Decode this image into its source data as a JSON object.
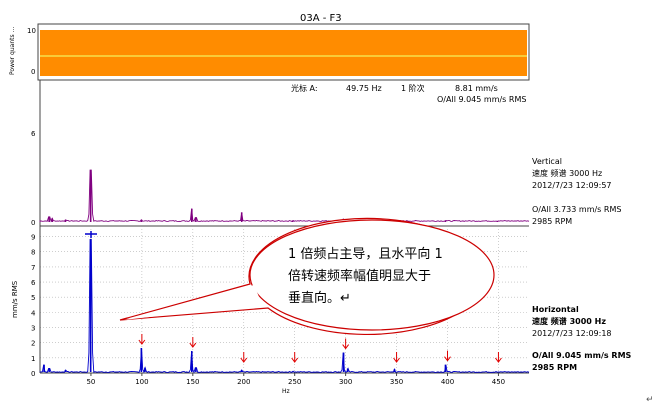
{
  "title": "03A - F3",
  "colors": {
    "power_band": "#ff8c00",
    "power_line": "#f5e04a",
    "vertical_line": "#800080",
    "horizontal_line": "#0000cc",
    "arrow": "#e00000",
    "callout_border": "#cc0000"
  },
  "power_panel": {
    "ylabel": "Power quants ...",
    "ticks": [
      "10",
      "0"
    ]
  },
  "cursor_readout": {
    "label": "光标 A:",
    "freq": "49.75 Hz",
    "order": "1 阶次",
    "amp": "8.81 mm/s",
    "overall": "O/All 9.045 mm/s RMS"
  },
  "vertical_panel": {
    "ticks": [
      "6",
      "0"
    ],
    "name": "Vertical",
    "spectrum": "速度 频谱 3000 Hz",
    "datetime": "2012/7/23 12:09:57",
    "overall": "O/All 3.733 mm/s RMS",
    "rpm": "2985 RPM"
  },
  "horizontal_panel": {
    "ylabel": "mm/s RMS",
    "ticks": [
      "9",
      "8",
      "7",
      "6",
      "5",
      "4",
      "3",
      "2",
      "1",
      "0"
    ],
    "name": "Horizontal",
    "spectrum": "速度 频谱 3000 Hz",
    "datetime": "2012/7/23 12:09:18",
    "overall": "O/All 9.045 mm/s RMS",
    "rpm": "2985 RPM"
  },
  "x_axis": {
    "label": "Hz",
    "ticks": [
      "50",
      "100",
      "150",
      "200",
      "250",
      "300",
      "350",
      "400",
      "450"
    ]
  },
  "callout": {
    "line1": "1 倍频占主导，且水平向 1",
    "line2": "倍转速频率幅值明显大于",
    "line3": "垂直向。↵"
  },
  "return_mark": "↵",
  "chart_data": {
    "type": "line",
    "x_range": [
      0,
      480
    ],
    "x_unit": "Hz",
    "series": [
      {
        "name": "Vertical",
        "y_range": [
          0,
          9
        ],
        "peaks": [
          [
            9,
            0.35
          ],
          [
            12,
            0.25
          ],
          [
            25,
            0.15
          ],
          [
            49.75,
            3.5
          ],
          [
            99.5,
            0.15
          ],
          [
            149,
            0.9
          ],
          [
            153,
            0.3
          ],
          [
            198,
            0.65
          ],
          [
            248,
            0.1
          ],
          [
            298,
            0.2
          ],
          [
            348,
            0.08
          ],
          [
            398,
            0.1
          ],
          [
            449,
            0.05
          ]
        ]
      },
      {
        "name": "Horizontal",
        "y_range": [
          0,
          9.5
        ],
        "peaks": [
          [
            4,
            0.55
          ],
          [
            9,
            0.3
          ],
          [
            25,
            0.2
          ],
          [
            49.75,
            8.81
          ],
          [
            99.5,
            1.65
          ],
          [
            103,
            0.35
          ],
          [
            149,
            1.45
          ],
          [
            153,
            0.35
          ],
          [
            198,
            0.2
          ],
          [
            248,
            0.12
          ],
          [
            298,
            1.35
          ],
          [
            302,
            0.3
          ],
          [
            348,
            0.25
          ],
          [
            398,
            0.55
          ],
          [
            448,
            0.1
          ]
        ]
      }
    ],
    "arrow_markers_hz": [
      100,
      150,
      200,
      250,
      300,
      350,
      400,
      450
    ]
  }
}
